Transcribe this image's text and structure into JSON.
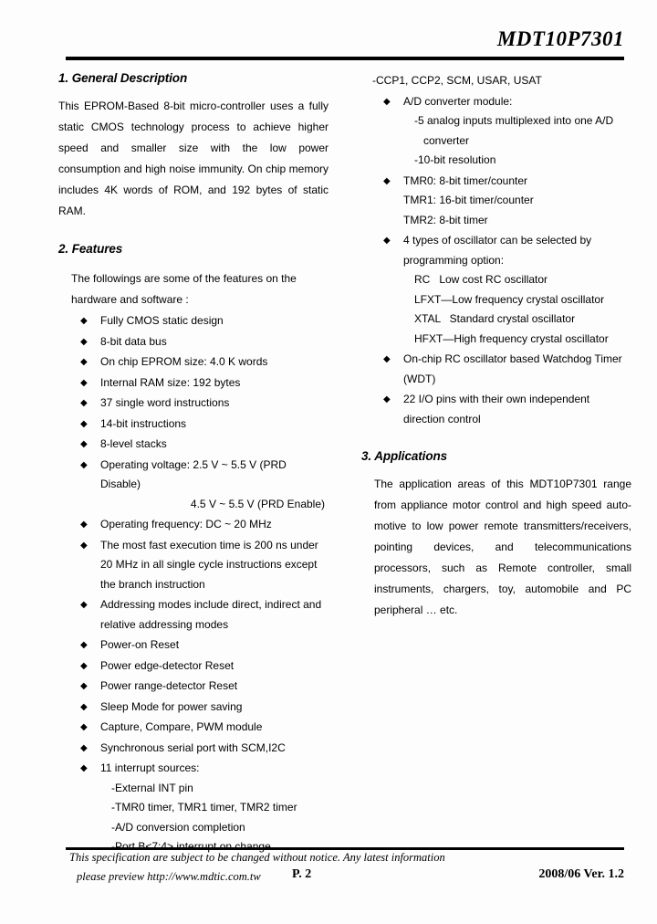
{
  "header": {
    "doc_title": "MDT10P7301"
  },
  "left": {
    "section1_title": "1. General Description",
    "description": "This EPROM-Based 8-bit micro-controller uses a fully static CMOS technology process to achieve higher speed and smaller size with the low power consumption and high noise immunity. On chip memory includes 4K words of ROM, and 192 bytes of static RAM.",
    "section2_title": "2. Features",
    "features_intro": "The followings are some of the features on the hardware and software :",
    "bullets": [
      {
        "text": "Fully CMOS static design"
      },
      {
        "text": "8-bit data bus"
      },
      {
        "text": "On chip EPROM size: 4.0 K words"
      },
      {
        "text": "Internal RAM size: 192 bytes"
      },
      {
        "text": "37 single word instructions"
      },
      {
        "text": "14-bit instructions"
      },
      {
        "text": "8-level stacks"
      },
      {
        "text": "Operating voltage: 2.5 V ~ 5.5 V (PRD Disable)",
        "cont_right": "4.5 V ~ 5.5 V (PRD Enable)"
      },
      {
        "text": "Operating frequency: DC ~ 20 MHz"
      },
      {
        "text": "The most fast execution time is 200 ns under",
        "cont": [
          "20 MHz in all single cycle instructions except",
          "the branch instruction"
        ]
      },
      {
        "text": "Addressing modes include direct, indirect and",
        "cont": [
          "relative addressing modes"
        ]
      },
      {
        "text": "Power-on Reset"
      },
      {
        "text": "Power edge-detector Reset"
      },
      {
        "text": "Power range-detector Reset"
      },
      {
        "text": "Sleep Mode for power saving"
      },
      {
        "text": "Capture, Compare, PWM module"
      },
      {
        "text": "Synchronous serial port with SCM,I2C"
      },
      {
        "text": "11 interrupt sources:",
        "sub": [
          "-External INT pin",
          "-TMR0 timer, TMR1 timer, TMR2 timer",
          "-A/D conversion completion",
          "-Port B<7:4> interrupt on change"
        ]
      }
    ]
  },
  "right": {
    "continued_sub": "-CCP1, CCP2, SCM, USAR, USAT",
    "bullets": [
      {
        "text": "A/D converter module:",
        "sub": [
          "-5 analog inputs multiplexed into one A/D",
          "-10-bit resolution"
        ],
        "sub_cont": "converter"
      },
      {
        "text": "TMR0: 8-bit timer/counter",
        "plain": [
          "TMR1: 16-bit timer/counter",
          "TMR2: 8-bit timer"
        ]
      },
      {
        "text": "4 types of oscillator can be selected by",
        "cont": [
          "programming option:"
        ],
        "osc": [
          "RC   Low cost RC oscillator",
          "LFXT—Low frequency crystal oscillator",
          "XTAL   Standard crystal oscillator",
          "HFXT—High frequency crystal oscillator"
        ]
      },
      {
        "text": "On-chip RC oscillator based Watchdog Timer",
        "cont": [
          "(WDT)"
        ]
      },
      {
        "text": "22 I/O pins with their own independent",
        "cont": [
          "direction control"
        ]
      }
    ],
    "section3_title": "3. Applications",
    "applications": "The application areas of this MDT10P7301 range from appliance motor control and high speed auto-motive to low power remote transmitters/receivers, pointing devices, and telecommunications processors, such as Remote controller, small instruments, chargers, toy, automobile and PC peripheral … etc."
  },
  "footer": {
    "notice_line1": "This specification are subject to be changed without notice. Any latest information",
    "notice_line2": "please preview http://www.mdtic.com.tw",
    "page_number": "P. 2",
    "version": "2008/06 Ver. 1.2"
  },
  "icons": {
    "bullet_diamond": "◆"
  }
}
